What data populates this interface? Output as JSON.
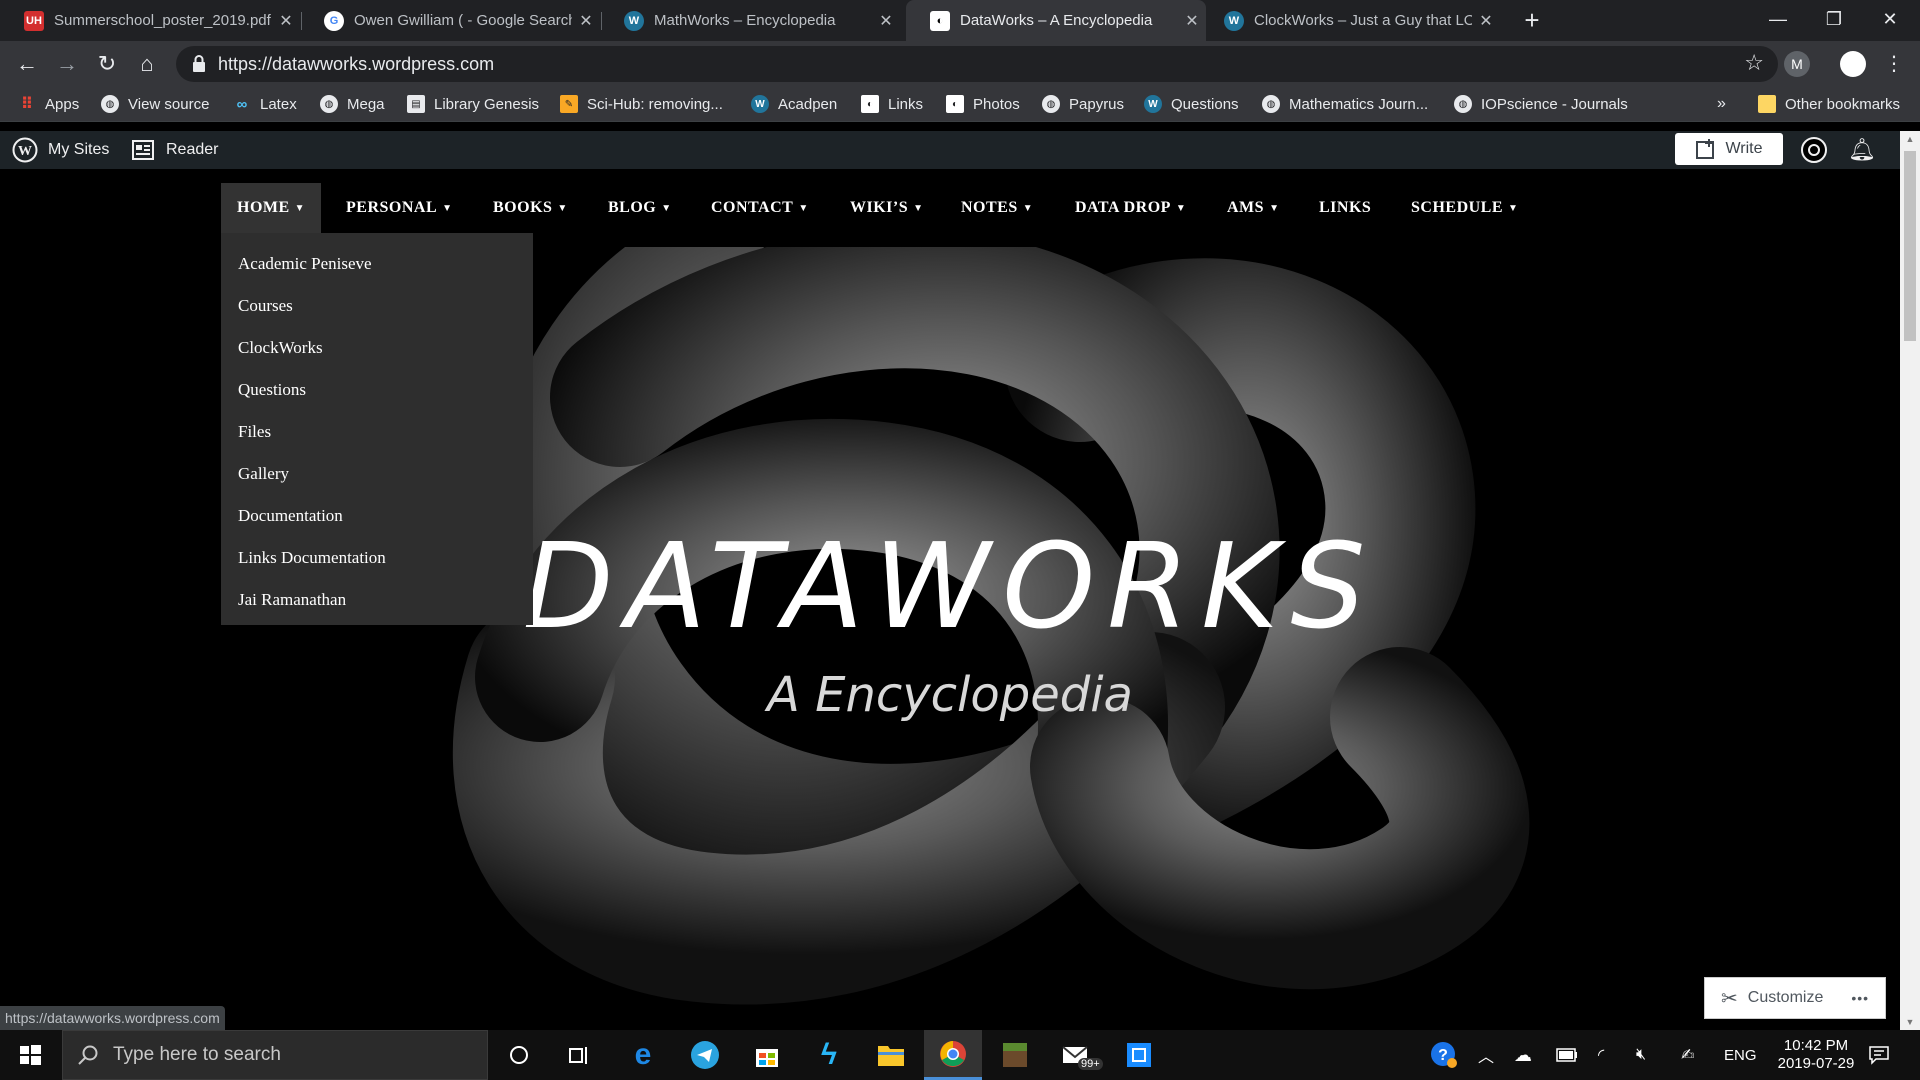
{
  "browser": {
    "tabs": [
      {
        "title": "Summerschool_poster_2019.pdf",
        "icon": "uh-pdf-icon",
        "color": "#d32f2f"
      },
      {
        "title": "Owen Gwilliam ( - Google Search",
        "icon": "google-icon",
        "color": "#ffffff"
      },
      {
        "title": "MathWorks – Encyclopedia",
        "icon": "wordpress-icon",
        "color": "#21759b"
      },
      {
        "title": "DataWorks – A Encyclopedia",
        "icon": "site-icon",
        "color": "#ffffff",
        "active": true
      },
      {
        "title": "ClockWorks – Just a Guy that LOV",
        "icon": "wordpress-icon",
        "color": "#21759b"
      }
    ],
    "url": "https://datawworks.wordpress.com",
    "profile_initial": "M",
    "bookmarks": [
      {
        "label": "Apps",
        "icon": "apps-grid-icon"
      },
      {
        "label": "View source",
        "icon": "globe-icon"
      },
      {
        "label": "Latex",
        "icon": "infinity-icon"
      },
      {
        "label": "Mega",
        "icon": "globe-icon"
      },
      {
        "label": "Library Genesis",
        "icon": "book-icon"
      },
      {
        "label": "Sci-Hub: removing...",
        "icon": "scihub-icon"
      },
      {
        "label": "Acadpen",
        "icon": "wordpress-icon"
      },
      {
        "label": "Links",
        "icon": "site-icon"
      },
      {
        "label": "Photos",
        "icon": "site-icon"
      },
      {
        "label": "Papyrus",
        "icon": "globe-icon"
      },
      {
        "label": "Questions",
        "icon": "wordpress-icon"
      },
      {
        "label": "Mathematics Journ...",
        "icon": "globe-icon"
      },
      {
        "label": "IOPscience - Journals",
        "icon": "globe-icon"
      }
    ],
    "other_bookmarks": "Other bookmarks",
    "overflow": "»",
    "status_url": "https://datawworks.wordpress.com"
  },
  "wpbar": {
    "my_sites": "My Sites",
    "reader": "Reader",
    "write": "Write"
  },
  "site": {
    "nav": [
      {
        "label": "HOME",
        "chevron": true,
        "active": true
      },
      {
        "label": "PERSONAL",
        "chevron": true
      },
      {
        "label": "BOOKS",
        "chevron": true
      },
      {
        "label": "BLOG",
        "chevron": true
      },
      {
        "label": "CONTACT",
        "chevron": true
      },
      {
        "label": "WIKI’S",
        "chevron": true
      },
      {
        "label": "NOTES",
        "chevron": true
      },
      {
        "label": "DATA DROP",
        "chevron": true
      },
      {
        "label": "AMS",
        "chevron": true
      },
      {
        "label": "LINKS",
        "chevron": false
      },
      {
        "label": "SCHEDULE",
        "chevron": true
      }
    ],
    "home_dropdown": [
      "Academic Peniseve",
      "Courses",
      "ClockWorks",
      "Questions",
      "Files",
      "Gallery",
      "Documentation",
      "Links Documentation",
      "Jai Ramanathan"
    ],
    "title": "DATAWORKS",
    "tagline": "A Encyclopedia",
    "customize": "Customize",
    "more": "•••"
  },
  "taskbar": {
    "search_placeholder": "Type here to search",
    "mail_badge": "99+",
    "language": "ENG",
    "time": "10:42 PM",
    "date": "2019-07-29"
  }
}
